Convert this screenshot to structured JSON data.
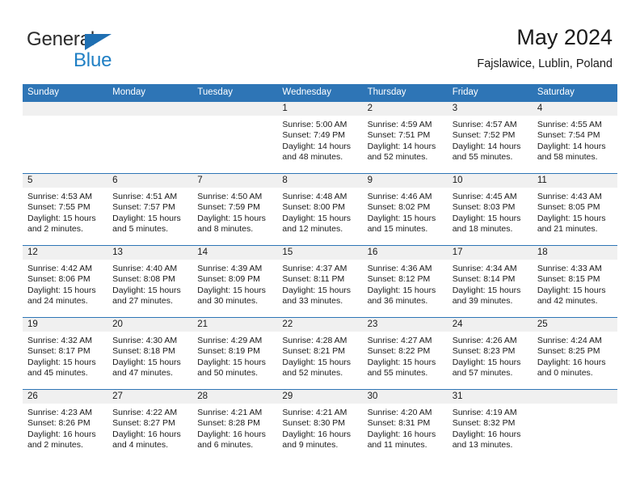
{
  "brand": {
    "line1": "General",
    "line2": "Blue",
    "logo_icon": "triangle-icon",
    "accent_color": "#1f7fc4"
  },
  "header": {
    "title": "May 2024",
    "subtitle": "Fajslawice, Lublin, Poland"
  },
  "theme": {
    "header_blue": "#2e75b6",
    "daynum_strip": "#f0f0f0",
    "text": "#1a1a1a"
  },
  "calendar": {
    "weekday_headers": [
      "Sunday",
      "Monday",
      "Tuesday",
      "Wednesday",
      "Thursday",
      "Friday",
      "Saturday"
    ],
    "weeks": [
      [
        {
          "day": "",
          "sunrise": "",
          "sunset": "",
          "daylight_line1": "",
          "daylight_line2": ""
        },
        {
          "day": "",
          "sunrise": "",
          "sunset": "",
          "daylight_line1": "",
          "daylight_line2": ""
        },
        {
          "day": "",
          "sunrise": "",
          "sunset": "",
          "daylight_line1": "",
          "daylight_line2": ""
        },
        {
          "day": "1",
          "sunrise": "Sunrise: 5:00 AM",
          "sunset": "Sunset: 7:49 PM",
          "daylight_line1": "Daylight: 14 hours",
          "daylight_line2": "and 48 minutes."
        },
        {
          "day": "2",
          "sunrise": "Sunrise: 4:59 AM",
          "sunset": "Sunset: 7:51 PM",
          "daylight_line1": "Daylight: 14 hours",
          "daylight_line2": "and 52 minutes."
        },
        {
          "day": "3",
          "sunrise": "Sunrise: 4:57 AM",
          "sunset": "Sunset: 7:52 PM",
          "daylight_line1": "Daylight: 14 hours",
          "daylight_line2": "and 55 minutes."
        },
        {
          "day": "4",
          "sunrise": "Sunrise: 4:55 AM",
          "sunset": "Sunset: 7:54 PM",
          "daylight_line1": "Daylight: 14 hours",
          "daylight_line2": "and 58 minutes."
        }
      ],
      [
        {
          "day": "5",
          "sunrise": "Sunrise: 4:53 AM",
          "sunset": "Sunset: 7:55 PM",
          "daylight_line1": "Daylight: 15 hours",
          "daylight_line2": "and 2 minutes."
        },
        {
          "day": "6",
          "sunrise": "Sunrise: 4:51 AM",
          "sunset": "Sunset: 7:57 PM",
          "daylight_line1": "Daylight: 15 hours",
          "daylight_line2": "and 5 minutes."
        },
        {
          "day": "7",
          "sunrise": "Sunrise: 4:50 AM",
          "sunset": "Sunset: 7:59 PM",
          "daylight_line1": "Daylight: 15 hours",
          "daylight_line2": "and 8 minutes."
        },
        {
          "day": "8",
          "sunrise": "Sunrise: 4:48 AM",
          "sunset": "Sunset: 8:00 PM",
          "daylight_line1": "Daylight: 15 hours",
          "daylight_line2": "and 12 minutes."
        },
        {
          "day": "9",
          "sunrise": "Sunrise: 4:46 AM",
          "sunset": "Sunset: 8:02 PM",
          "daylight_line1": "Daylight: 15 hours",
          "daylight_line2": "and 15 minutes."
        },
        {
          "day": "10",
          "sunrise": "Sunrise: 4:45 AM",
          "sunset": "Sunset: 8:03 PM",
          "daylight_line1": "Daylight: 15 hours",
          "daylight_line2": "and 18 minutes."
        },
        {
          "day": "11",
          "sunrise": "Sunrise: 4:43 AM",
          "sunset": "Sunset: 8:05 PM",
          "daylight_line1": "Daylight: 15 hours",
          "daylight_line2": "and 21 minutes."
        }
      ],
      [
        {
          "day": "12",
          "sunrise": "Sunrise: 4:42 AM",
          "sunset": "Sunset: 8:06 PM",
          "daylight_line1": "Daylight: 15 hours",
          "daylight_line2": "and 24 minutes."
        },
        {
          "day": "13",
          "sunrise": "Sunrise: 4:40 AM",
          "sunset": "Sunset: 8:08 PM",
          "daylight_line1": "Daylight: 15 hours",
          "daylight_line2": "and 27 minutes."
        },
        {
          "day": "14",
          "sunrise": "Sunrise: 4:39 AM",
          "sunset": "Sunset: 8:09 PM",
          "daylight_line1": "Daylight: 15 hours",
          "daylight_line2": "and 30 minutes."
        },
        {
          "day": "15",
          "sunrise": "Sunrise: 4:37 AM",
          "sunset": "Sunset: 8:11 PM",
          "daylight_line1": "Daylight: 15 hours",
          "daylight_line2": "and 33 minutes."
        },
        {
          "day": "16",
          "sunrise": "Sunrise: 4:36 AM",
          "sunset": "Sunset: 8:12 PM",
          "daylight_line1": "Daylight: 15 hours",
          "daylight_line2": "and 36 minutes."
        },
        {
          "day": "17",
          "sunrise": "Sunrise: 4:34 AM",
          "sunset": "Sunset: 8:14 PM",
          "daylight_line1": "Daylight: 15 hours",
          "daylight_line2": "and 39 minutes."
        },
        {
          "day": "18",
          "sunrise": "Sunrise: 4:33 AM",
          "sunset": "Sunset: 8:15 PM",
          "daylight_line1": "Daylight: 15 hours",
          "daylight_line2": "and 42 minutes."
        }
      ],
      [
        {
          "day": "19",
          "sunrise": "Sunrise: 4:32 AM",
          "sunset": "Sunset: 8:17 PM",
          "daylight_line1": "Daylight: 15 hours",
          "daylight_line2": "and 45 minutes."
        },
        {
          "day": "20",
          "sunrise": "Sunrise: 4:30 AM",
          "sunset": "Sunset: 8:18 PM",
          "daylight_line1": "Daylight: 15 hours",
          "daylight_line2": "and 47 minutes."
        },
        {
          "day": "21",
          "sunrise": "Sunrise: 4:29 AM",
          "sunset": "Sunset: 8:19 PM",
          "daylight_line1": "Daylight: 15 hours",
          "daylight_line2": "and 50 minutes."
        },
        {
          "day": "22",
          "sunrise": "Sunrise: 4:28 AM",
          "sunset": "Sunset: 8:21 PM",
          "daylight_line1": "Daylight: 15 hours",
          "daylight_line2": "and 52 minutes."
        },
        {
          "day": "23",
          "sunrise": "Sunrise: 4:27 AM",
          "sunset": "Sunset: 8:22 PM",
          "daylight_line1": "Daylight: 15 hours",
          "daylight_line2": "and 55 minutes."
        },
        {
          "day": "24",
          "sunrise": "Sunrise: 4:26 AM",
          "sunset": "Sunset: 8:23 PM",
          "daylight_line1": "Daylight: 15 hours",
          "daylight_line2": "and 57 minutes."
        },
        {
          "day": "25",
          "sunrise": "Sunrise: 4:24 AM",
          "sunset": "Sunset: 8:25 PM",
          "daylight_line1": "Daylight: 16 hours",
          "daylight_line2": "and 0 minutes."
        }
      ],
      [
        {
          "day": "26",
          "sunrise": "Sunrise: 4:23 AM",
          "sunset": "Sunset: 8:26 PM",
          "daylight_line1": "Daylight: 16 hours",
          "daylight_line2": "and 2 minutes."
        },
        {
          "day": "27",
          "sunrise": "Sunrise: 4:22 AM",
          "sunset": "Sunset: 8:27 PM",
          "daylight_line1": "Daylight: 16 hours",
          "daylight_line2": "and 4 minutes."
        },
        {
          "day": "28",
          "sunrise": "Sunrise: 4:21 AM",
          "sunset": "Sunset: 8:28 PM",
          "daylight_line1": "Daylight: 16 hours",
          "daylight_line2": "and 6 minutes."
        },
        {
          "day": "29",
          "sunrise": "Sunrise: 4:21 AM",
          "sunset": "Sunset: 8:30 PM",
          "daylight_line1": "Daylight: 16 hours",
          "daylight_line2": "and 9 minutes."
        },
        {
          "day": "30",
          "sunrise": "Sunrise: 4:20 AM",
          "sunset": "Sunset: 8:31 PM",
          "daylight_line1": "Daylight: 16 hours",
          "daylight_line2": "and 11 minutes."
        },
        {
          "day": "31",
          "sunrise": "Sunrise: 4:19 AM",
          "sunset": "Sunset: 8:32 PM",
          "daylight_line1": "Daylight: 16 hours",
          "daylight_line2": "and 13 minutes."
        },
        {
          "day": "",
          "sunrise": "",
          "sunset": "",
          "daylight_line1": "",
          "daylight_line2": ""
        }
      ]
    ]
  }
}
